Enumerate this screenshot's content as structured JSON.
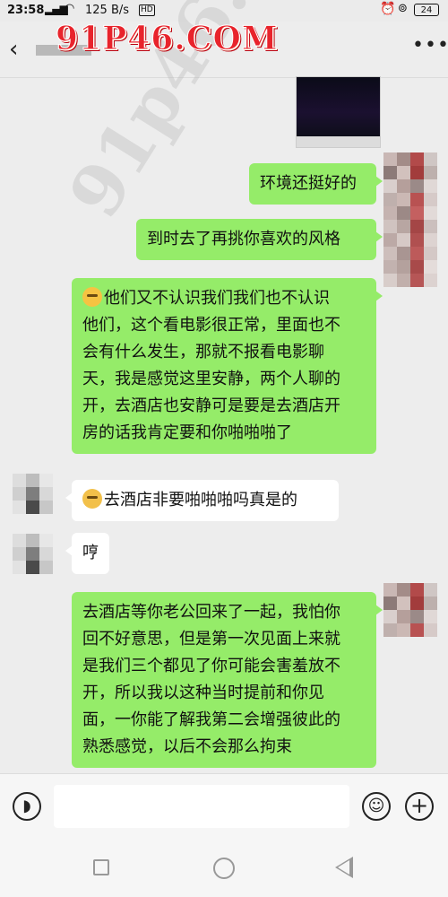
{
  "status_bar": {
    "time": "23:58",
    "network_speed": "125 B/s",
    "hd_label": "HD",
    "battery": "24"
  },
  "watermark": {
    "top": "91P46.COM",
    "diagonal": "91p46.com"
  },
  "messages": [
    {
      "side": "right",
      "text": "环境还挺好的"
    },
    {
      "side": "right",
      "text": "到时去了再挑你喜欢的风格"
    },
    {
      "side": "right",
      "emoji": "laughing-tears-emoji",
      "lines": [
        "他们又不认识我们我们也不认识",
        "他们，这个看电影很正常，里面也不",
        "会有什么发生，那就不报看电影聊",
        "天，我是感觉这里安静，两个人聊的",
        "开，去酒店也安静可是要是去酒店开",
        "房的话我肯定要和你啪啪啪了"
      ]
    },
    {
      "side": "left",
      "emoji": "sweat-face-emoji",
      "text": "去酒店非要啪啪啪吗真是的"
    },
    {
      "side": "left",
      "text": "哼"
    },
    {
      "side": "right",
      "lines": [
        "去酒店等你老公回来了一起，我怕你",
        "回不好意思，但是第一次见面上来就",
        "是我们三个都见了你可能会害羞放不",
        "开，所以我以这种当时提前和你见",
        "面，一你能了解我第二会增强彼此的",
        "熟悉感觉，以后不会那么拘束"
      ]
    }
  ],
  "colors": {
    "my_bubble": "#95ec69",
    "their_bubble": "#ffffff",
    "background": "#ededed",
    "watermark": "#e8242c"
  }
}
